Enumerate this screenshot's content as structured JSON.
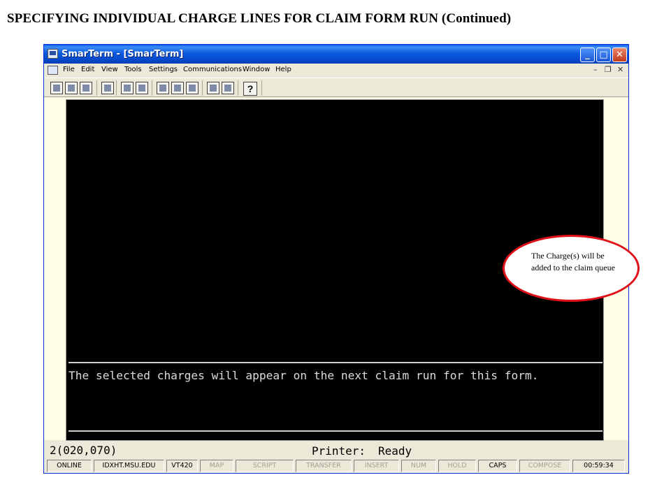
{
  "slide": {
    "title": "SPECIFYING INDIVIDUAL  CHARGE LINES FOR CLAIM FORM RUN (Continued)"
  },
  "window": {
    "title": "SmarTerm - [SmarTerm]",
    "caption_buttons": {
      "minimize": "_",
      "maximize": "□",
      "close": "✕"
    }
  },
  "menubar": {
    "items": [
      "File",
      "Edit",
      "View",
      "Tools",
      "Settings",
      "Communications",
      "Window",
      "Help"
    ],
    "mdi_controls": {
      "minimize": "–",
      "restore": "❐",
      "close": "✕"
    }
  },
  "toolbar": {
    "buttons": [
      "new-icon",
      "open-icon",
      "save-icon",
      "print-icon",
      "copy-icon",
      "paste-icon",
      "folder-icon",
      "keyboard-icon",
      "table-icon",
      "send-icon",
      "receive-icon"
    ],
    "help_label": "?"
  },
  "terminal": {
    "message": "The selected charges will appear on the next claim run for this form."
  },
  "statusline": {
    "cursor_position": "2(020,070)",
    "printer_label": "Printer:",
    "printer_status": "Ready"
  },
  "indicators": [
    {
      "label": "ONLINE",
      "active": true
    },
    {
      "label": "IDXHT.MSU.EDU",
      "active": true
    },
    {
      "label": "VT420",
      "active": true
    },
    {
      "label": "MAP",
      "active": false
    },
    {
      "label": "SCRIPT",
      "active": false
    },
    {
      "label": "TRANSFER",
      "active": false
    },
    {
      "label": "INSERT",
      "active": false
    },
    {
      "label": "NUM",
      "active": false
    },
    {
      "label": "HOLD",
      "active": false
    },
    {
      "label": "CAPS",
      "active": true
    },
    {
      "label": "COMPOSE",
      "active": false
    },
    {
      "label": "00:59:34",
      "active": true
    }
  ],
  "callout": {
    "text": "The Charge(s) will be added to the claim queue"
  },
  "colors": {
    "titlebar_blue": "#0d5ae0",
    "callout_border": "#e0101a",
    "terminal_bg": "#000000",
    "terminal_text": "#dcdcdc"
  }
}
